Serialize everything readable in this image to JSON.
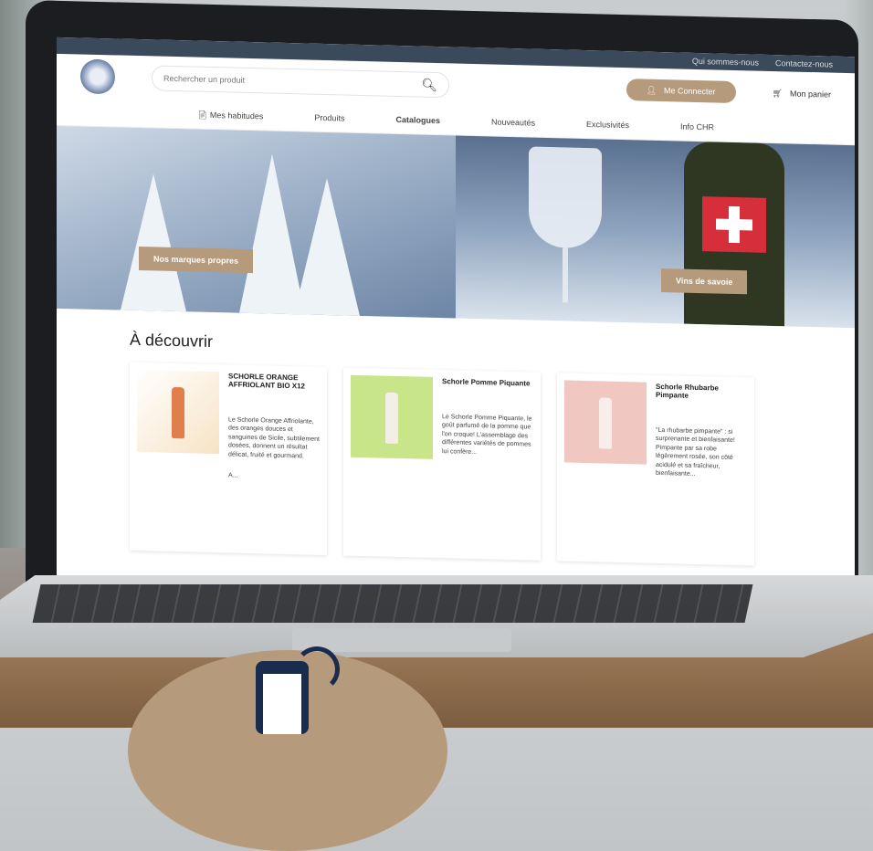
{
  "topbar": {
    "links": [
      "Qui sommes-nous",
      "Contactez-nous"
    ]
  },
  "header": {
    "search_placeholder": "Rechercher un produit",
    "connect_label": "Me Connecter",
    "cart_label": "Mon panier"
  },
  "nav": {
    "items": [
      "Mes habitudes",
      "Produits",
      "Catalogues",
      "Nouveautés",
      "Exclusivités",
      "Info CHR"
    ]
  },
  "hero": {
    "left_button": "Nos marques propres",
    "right_button": "Vins de savoie"
  },
  "discover": {
    "title": "À découvrir",
    "cards": [
      {
        "title": "SCHORLE ORANGE AFFRIOLANT BIO X12",
        "desc": "Le Schorle Orange Affriolante, des oranges douces et sanguines de Sicile, subtilement dosées, donnent un résultat délicat, fruité et gourmand.",
        "more": "A..."
      },
      {
        "title": "Schorle Pomme Piquante",
        "desc": "Le Schorle Pomme Piquante, le goût parfumé de la pomme que l'on croque! L'assemblage des différentes variétés de pommes lui confère...",
        "more": ""
      },
      {
        "title": "Schorle Rhubarbe Pimpante",
        "desc": "\"La rhubarbe pimpante\" : si surprenante et bienfaisante! Pimpante par sa robe légèrement rosée, son côté acidulé et sa fraîcheur, bienfaisante...",
        "more": ""
      }
    ]
  }
}
